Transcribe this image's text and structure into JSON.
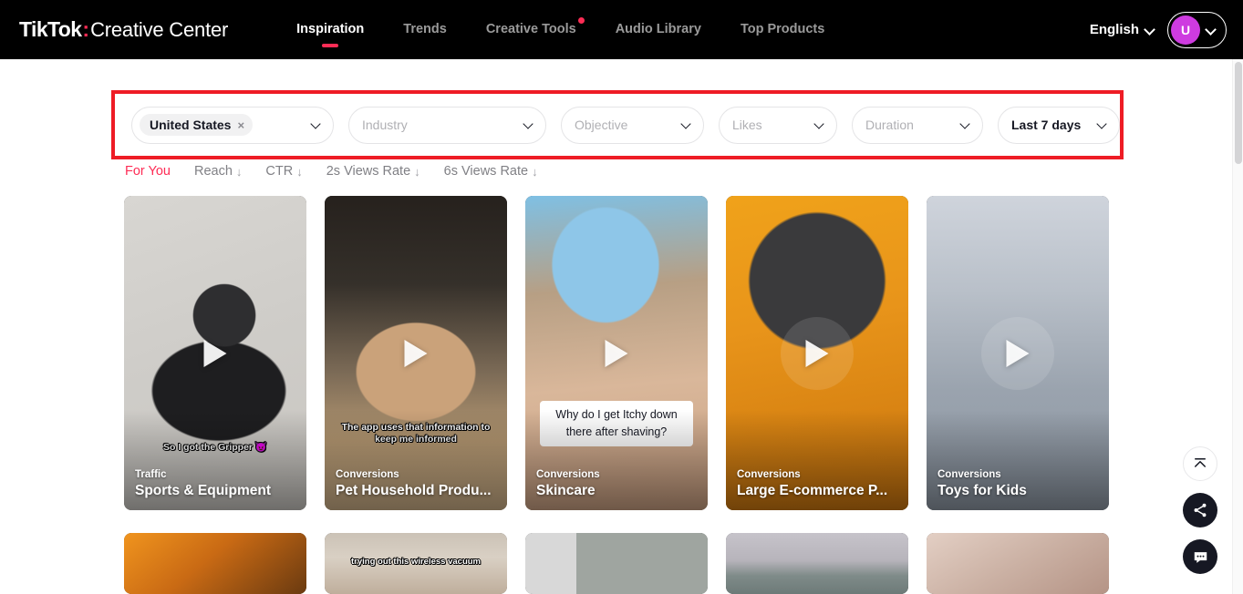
{
  "header": {
    "brand_tiktok": "TikTok",
    "brand_colon": ":",
    "brand_creative_center": "Creative Center",
    "nav": [
      {
        "label": "Inspiration",
        "active": true,
        "dot": false
      },
      {
        "label": "Trends",
        "active": false,
        "dot": false
      },
      {
        "label": "Creative Tools",
        "active": false,
        "dot": true
      },
      {
        "label": "Audio Library",
        "active": false,
        "dot": false
      },
      {
        "label": "Top Products",
        "active": false,
        "dot": false
      }
    ],
    "language": "English",
    "avatar_initial": "U"
  },
  "filters": {
    "country": {
      "chip_label": "United States",
      "chip_remove": "×"
    },
    "industry": {
      "placeholder": "Industry"
    },
    "objective": {
      "placeholder": "Objective"
    },
    "likes": {
      "placeholder": "Likes"
    },
    "duration": {
      "placeholder": "Duration"
    },
    "date_range": {
      "value": "Last 7 days"
    },
    "highlight_color": "#EE1C25"
  },
  "sorts": [
    {
      "label": "For You",
      "active": true,
      "arrow": ""
    },
    {
      "label": "Reach",
      "active": false,
      "arrow": "↓"
    },
    {
      "label": "CTR",
      "active": false,
      "arrow": "↓"
    },
    {
      "label": "2s Views Rate",
      "active": false,
      "arrow": "↓"
    },
    {
      "label": "6s Views Rate",
      "active": false,
      "arrow": "↓"
    }
  ],
  "cards": [
    {
      "objective": "Traffic",
      "title": "Sports & Equipment",
      "caption": "So I got the Gripper 😈"
    },
    {
      "objective": "Conversions",
      "title": "Pet Household Produ...",
      "caption": "The app uses that information to keep me informed"
    },
    {
      "objective": "Conversions",
      "title": "Skincare",
      "caption": "Why do I get Itchy down there after shaving?"
    },
    {
      "objective": "Conversions",
      "title": "Large E-commerce P...",
      "caption": ""
    },
    {
      "objective": "Conversions",
      "title": "Toys for Kids",
      "caption": ""
    }
  ],
  "cards_row2": [
    {
      "caption": ""
    },
    {
      "caption": "trying out this wireless vacuum"
    },
    {
      "caption": ""
    },
    {
      "caption": ""
    },
    {
      "caption": ""
    }
  ],
  "fabs": [
    {
      "name": "scroll-to-top",
      "glyph": "⤒"
    },
    {
      "name": "share",
      "glyph": "share"
    },
    {
      "name": "feedback",
      "glyph": "chat"
    }
  ]
}
